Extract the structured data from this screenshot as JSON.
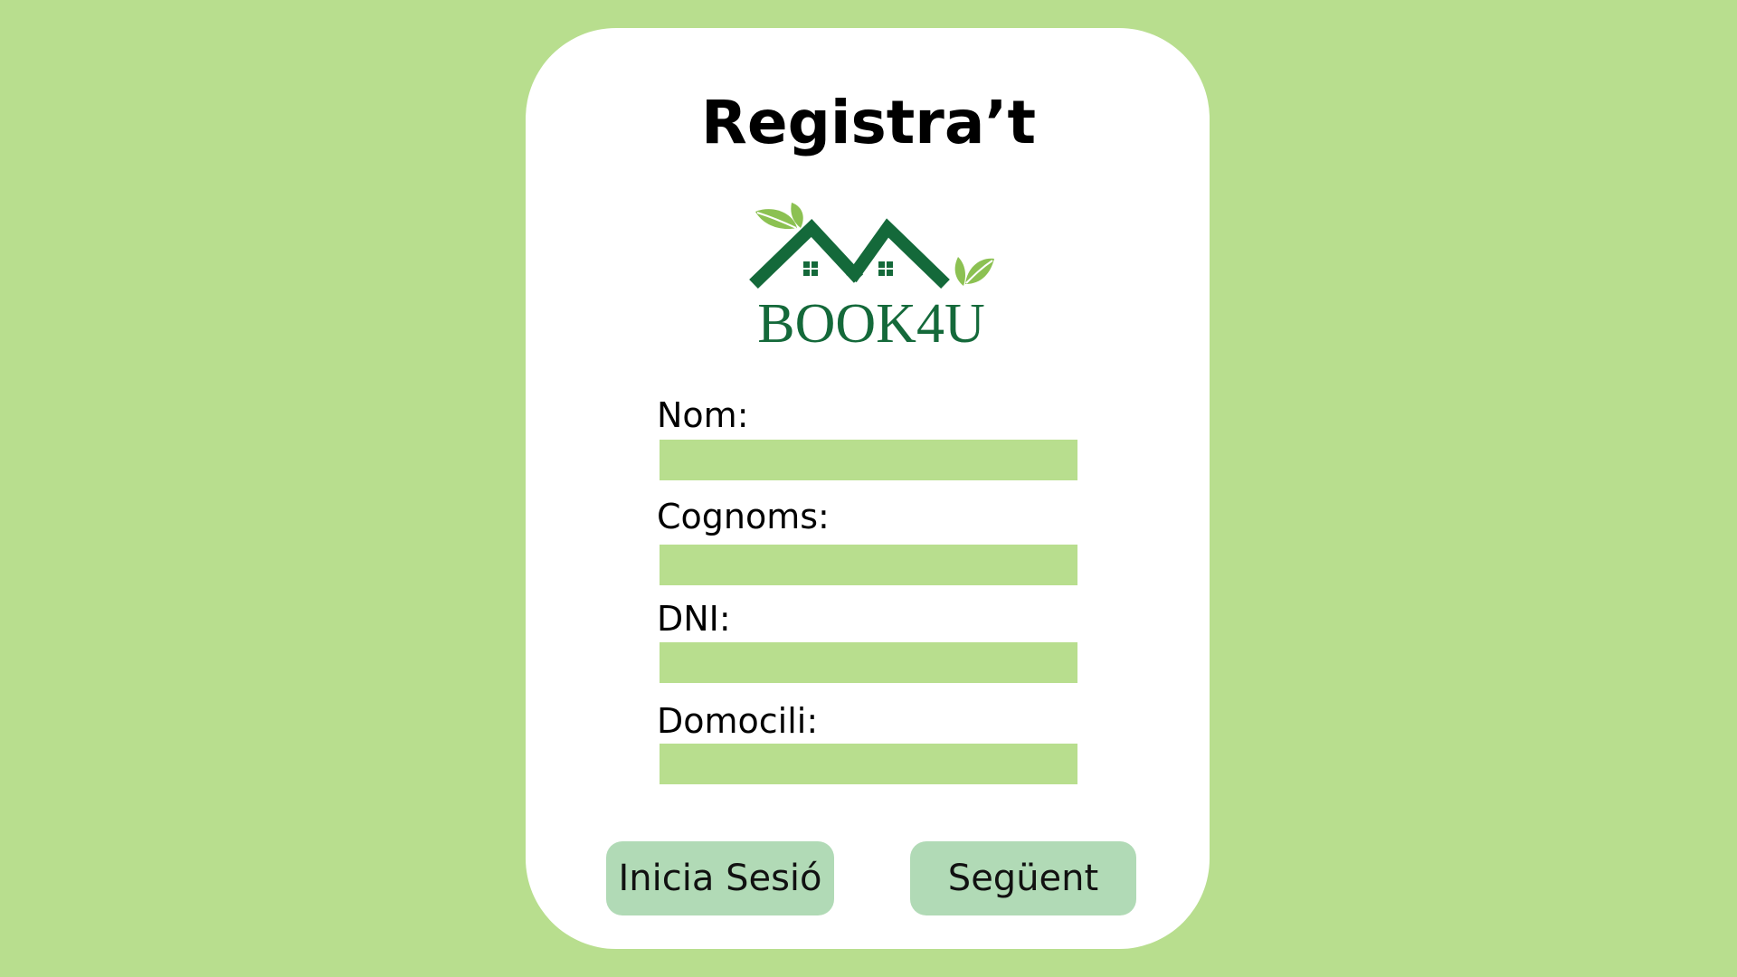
{
  "form": {
    "title": "Registra’t",
    "logo": {
      "icon": "house-roofs-with-leaves-icon",
      "text": "BOOK4U",
      "colors": {
        "dark_green": "#14693a",
        "leaf_green": "#8cc152"
      }
    },
    "fields": [
      {
        "label": "Nom:",
        "value": "",
        "placeholder": ""
      },
      {
        "label": "Cognoms:",
        "value": "",
        "placeholder": ""
      },
      {
        "label": "DNI:",
        "value": "",
        "placeholder": ""
      },
      {
        "label": "Domocili:",
        "value": "",
        "placeholder": ""
      }
    ],
    "buttons": {
      "login_label": "Inicia Sesió",
      "next_label": "Següent"
    }
  },
  "colors": {
    "background": "#b8de8e",
    "card": "#ffffff",
    "input_fill": "#b8de8e",
    "button_fill": "#b1dab6"
  }
}
